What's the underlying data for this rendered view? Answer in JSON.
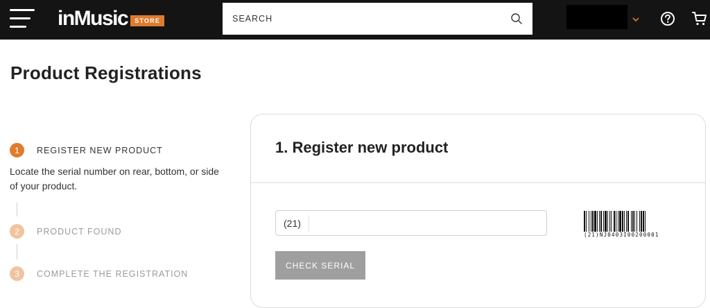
{
  "header": {
    "logo_text": "inMusic",
    "logo_badge": "STORE",
    "search_placeholder": "SEARCH",
    "accent_color": "#e07b2e"
  },
  "page": {
    "title": "Product Registrations"
  },
  "steps": [
    {
      "number": "1",
      "label": "REGISTER NEW PRODUCT",
      "state": "active",
      "color": "#e07b2e"
    },
    {
      "number": "2",
      "label": "PRODUCT FOUND",
      "state": "pending",
      "color": "#f2c3a0"
    },
    {
      "number": "3",
      "label": "COMPLETE THE REGISTRATION",
      "state": "pending",
      "color": "#f2c3a0"
    }
  ],
  "step_description": "Locate the serial number on rear, bottom, or side of your product.",
  "card": {
    "title": "1. Register new product",
    "serial_prefix": "(21)",
    "serial_value": "",
    "check_button": "CHECK SERIAL",
    "barcode_text": "(21)NJ0403I00200001"
  },
  "icons": {
    "menu": "hamburger-icon",
    "search": "search-icon",
    "caret": "chevron-down-icon",
    "help": "help-circle-icon",
    "cart": "cart-icon"
  }
}
